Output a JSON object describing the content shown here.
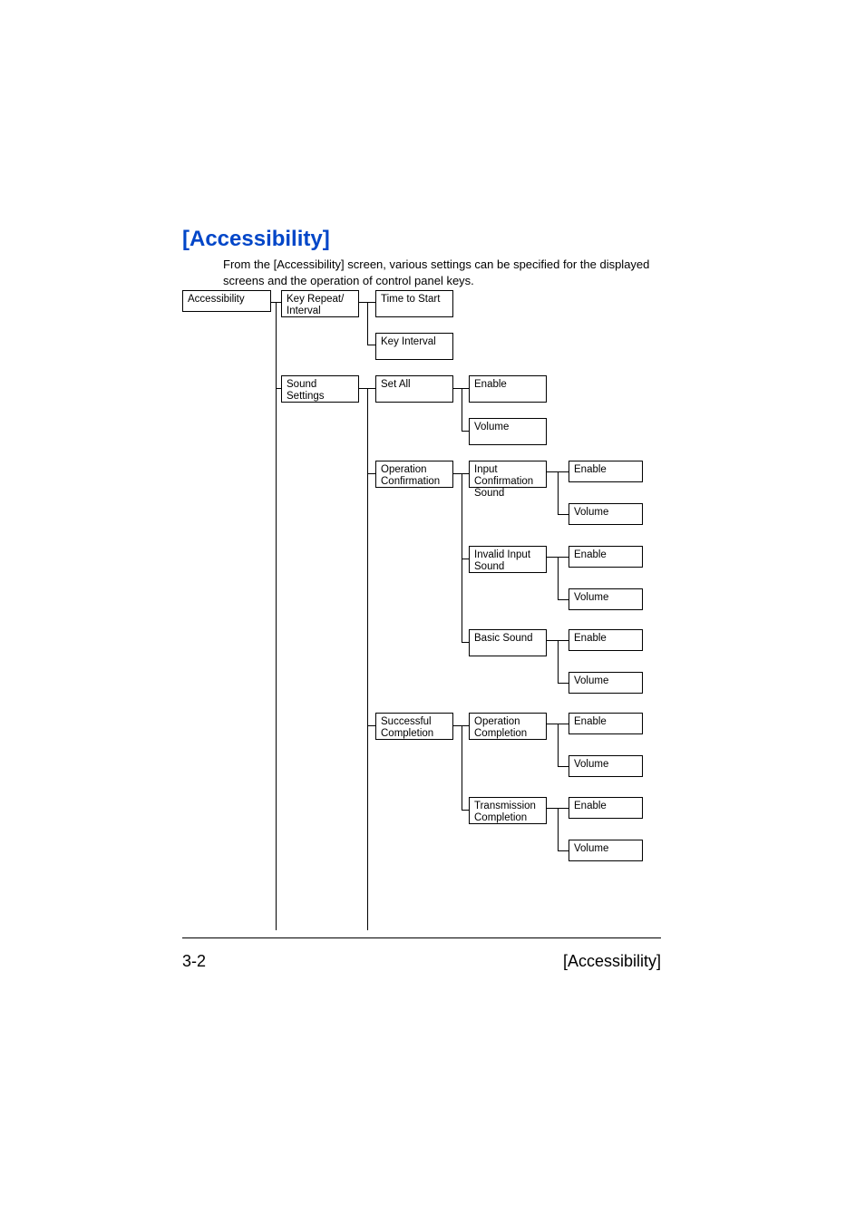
{
  "heading": "[Accessibility]",
  "intro": "From the [Accessibility] screen, various settings can be specified for the displayed screens and the operation of control panel keys.",
  "footer": {
    "left": "3-2",
    "right": "[Accessibility]"
  },
  "tree": {
    "root": "Accessibility",
    "children": [
      {
        "label": "Key Repeat/\nInterval",
        "children": [
          {
            "label": "Time to Start"
          },
          {
            "label": "Key Interval"
          }
        ]
      },
      {
        "label": "Sound Settings",
        "children": [
          {
            "label": "Set All",
            "children": [
              {
                "label": "Enable"
              },
              {
                "label": "Volume"
              }
            ]
          },
          {
            "label": "Operation\nConfirmation",
            "children": [
              {
                "label": "Input Confirmation Sound",
                "children": [
                  {
                    "label": "Enable"
                  },
                  {
                    "label": "Volume"
                  }
                ]
              },
              {
                "label": "Invalid Input\nSound",
                "children": [
                  {
                    "label": "Enable"
                  },
                  {
                    "label": "Volume"
                  }
                ]
              },
              {
                "label": "Basic Sound",
                "children": [
                  {
                    "label": "Enable"
                  },
                  {
                    "label": "Volume"
                  }
                ]
              }
            ]
          },
          {
            "label": "Successful\nCompletion",
            "children": [
              {
                "label": "Operation\nCompletion",
                "children": [
                  {
                    "label": "Enable"
                  },
                  {
                    "label": "Volume"
                  }
                ]
              },
              {
                "label": "Transmission\nCompletion",
                "children": [
                  {
                    "label": "Enable"
                  },
                  {
                    "label": "Volume"
                  }
                ]
              }
            ]
          }
        ]
      }
    ]
  }
}
